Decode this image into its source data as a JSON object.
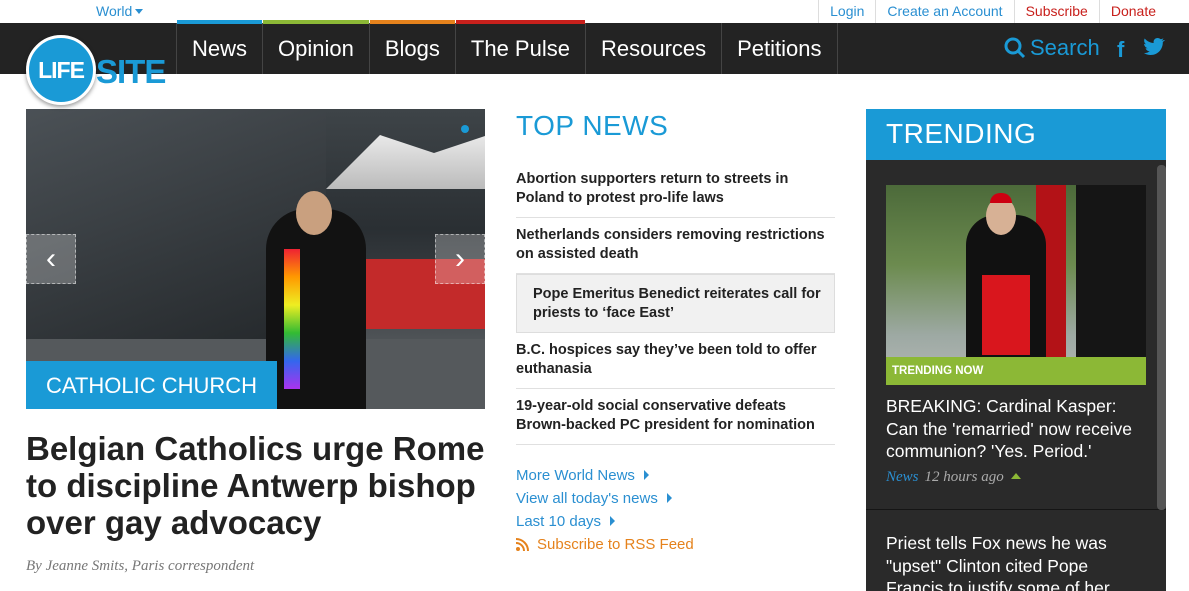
{
  "header": {
    "region": "World",
    "util_links": [
      {
        "label": "Login",
        "color": "#2a8fd1"
      },
      {
        "label": "Create an Account",
        "color": "#2a8fd1"
      },
      {
        "label": "Subscribe",
        "color": "#c8201c"
      },
      {
        "label": "Donate",
        "color": "#c8201c"
      }
    ],
    "logo_left": "LIFE",
    "logo_right": "SITE",
    "nav": [
      {
        "label": "News",
        "accent": "#1a9ad6"
      },
      {
        "label": "Opinion",
        "accent": "#8cb836"
      },
      {
        "label": "Blogs",
        "accent": "#e5821c"
      },
      {
        "label": "The Pulse",
        "accent": "#c8201c"
      },
      {
        "label": "Resources",
        "accent": ""
      },
      {
        "label": "Petitions",
        "accent": ""
      }
    ],
    "search_label": "Search",
    "social": [
      "facebook-icon",
      "twitter-icon"
    ]
  },
  "hero": {
    "category": "CATHOLIC CHURCH",
    "headline": "Belgian Catholics urge Rome to discipline Antwerp bishop over gay advocacy",
    "byline": "By Jeanne Smits, Paris correspondent"
  },
  "top_news": {
    "title": "TOP NEWS",
    "items": [
      "Abortion supporters return to streets in Poland to protest pro-life laws",
      "Netherlands considers removing restrictions on assisted death",
      "Pope Emeritus Benedict reiterates call for priests to ‘face East’",
      "B.C. hospices say they’ve been told to offer euthanasia",
      "19-year-old social conservative defeats Brown-backed PC president for nomination"
    ],
    "links": [
      "More World News",
      "View all today's news",
      "Last 10 days"
    ],
    "rss": "Subscribe to RSS Feed"
  },
  "trending": {
    "title": "TRENDING",
    "badge": "TRENDING NOW",
    "story_title": "BREAKING: Cardinal Kasper: Can the 'remarried' now receive communion? 'Yes. Period.'",
    "section": "News",
    "time": "12 hours ago",
    "story2_title": "Priest tells Fox news he was \"upset\" Clinton cited Pope Francis to justify some of her"
  }
}
